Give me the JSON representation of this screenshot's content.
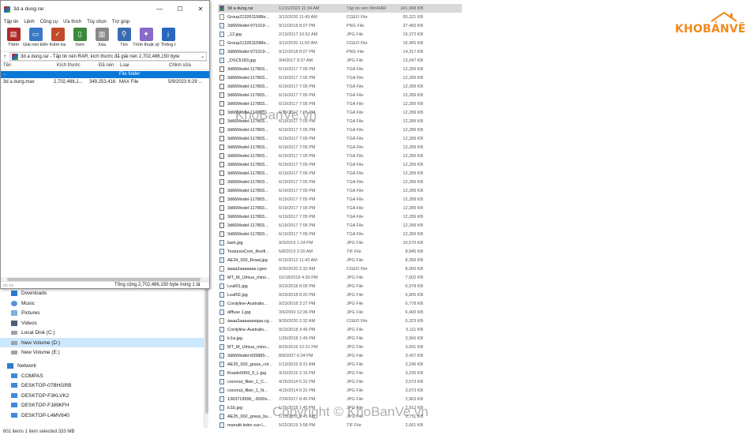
{
  "winrar": {
    "title": "3d a dung.rar",
    "window_controls": {
      "minimize": "—",
      "maximize": "☐",
      "close": "✕"
    },
    "menu": [
      "Tập tin",
      "Lệnh",
      "Công cụ",
      "Ưa thích",
      "Tùy chọn",
      "Trợ giúp"
    ],
    "toolbar": [
      {
        "label": "Thêm",
        "icon": "add-archive-icon",
        "color": "#b02a2a"
      },
      {
        "label": "Giải nén Đến",
        "icon": "extract-folder-icon",
        "color": "#3a78c8"
      },
      {
        "label": "Kiểm tra",
        "icon": "test-clipboard-icon",
        "color": "#c24a2a"
      },
      {
        "label": "Xem",
        "icon": "view-book-icon",
        "color": "#3a8a3a"
      },
      {
        "label": "Xóa",
        "icon": "delete-trash-icon",
        "color": "#8a8a8a"
      },
      {
        "label": "Tìm",
        "icon": "find-magnifier-icon",
        "color": "#3a6ab0"
      },
      {
        "label": "Trình thuật sỹ",
        "icon": "wizard-wand-icon",
        "color": "#8a6ac8"
      },
      {
        "label": "Thông t",
        "icon": "info-icon",
        "color": "#2a68c0"
      }
    ],
    "address": "3d a dung.rar - Tập tin nén RAR, kích thước đã giải nén 2,702,486,150 byte",
    "columns": [
      "Tên",
      "Kích thước",
      "Đã nén",
      "Loại",
      "Chỉnh sửa"
    ],
    "rows": [
      {
        "name": "..",
        "size": "",
        "packed": "",
        "type": "File folder",
        "modified": ""
      },
      {
        "name": "3d a dung.max",
        "size": "2,702,486,1...",
        "packed": "349,253,416",
        "type": "MAX File",
        "modified": "5/9/2023 6:29 ..."
      }
    ],
    "status_total": "Tổng cộng 2,702,486,150 byte trong 1 tậ"
  },
  "explorer": {
    "nav": [
      {
        "label": "Downloads",
        "icon": "downloads-icon"
      },
      {
        "label": "Music",
        "icon": "music-icon"
      },
      {
        "label": "Pictures",
        "icon": "pictures-icon"
      },
      {
        "label": "Videos",
        "icon": "videos-icon"
      },
      {
        "label": "Local Disk (C:)",
        "icon": "disk-icon"
      },
      {
        "label": "New Volume (D:)",
        "icon": "disk-icon"
      },
      {
        "label": "New Volume (E:)",
        "icon": "disk-icon"
      },
      {
        "label": "Network",
        "icon": "network-icon"
      },
      {
        "label": "COMPAS",
        "icon": "computer-icon"
      },
      {
        "label": "DESKTOP-07BHGRB",
        "icon": "computer-icon"
      },
      {
        "label": "DESKTOP-F3KLVK2",
        "icon": "computer-icon"
      },
      {
        "label": "DESKTOP-FJ89KFH",
        "icon": "computer-icon"
      },
      {
        "label": "DESKTOP-L4MV840",
        "icon": "computer-icon"
      }
    ],
    "status": "601 items     1 item selected  333 MB"
  },
  "files": [
    {
      "name": "3d a dung.rar",
      "date": "11/15/2023 11:34 AM",
      "type": "Tập tin nén WinRAR",
      "size": "341,068 KB",
      "kind": "rar"
    },
    {
      "name": "Group2132611588e...",
      "date": "3/13/2020 11:43 AM",
      "type": "CGEO File",
      "size": "65,321 KB",
      "kind": "doc"
    },
    {
      "name": "3d66Model-971019-...",
      "date": "9/12/2018 8:07 PM",
      "type": "PNG File",
      "size": "37,483 KB",
      "kind": "img"
    },
    {
      "name": "_12.jpg",
      "date": "2/13/2017 10:52 AM",
      "type": "JPG File",
      "size": "19,372 KB",
      "kind": "img"
    },
    {
      "name": "Group2132611588e...",
      "date": "3/13/2020 11:50 AM",
      "type": "CGEO File",
      "size": "16,465 KB",
      "kind": "doc"
    },
    {
      "name": "3d66Model-971019-...",
      "date": "9/12/2018 8:07 PM",
      "type": "PNG File",
      "size": "14,317 KB",
      "kind": "img"
    },
    {
      "name": "_DSC5183.jpg",
      "date": "3/4/2017 9:37 AM",
      "type": "JPG File",
      "size": "13,047 KB",
      "kind": "img"
    },
    {
      "name": "3d66Model-117803...",
      "date": "6/19/2017 7:05 PM",
      "type": "TGA File",
      "size": "12,289 KB",
      "kind": "tga"
    },
    {
      "name": "3d66Model-117803...",
      "date": "6/19/2017 7:05 PM",
      "type": "TGA File",
      "size": "12,289 KB",
      "kind": "tga"
    },
    {
      "name": "3d66Model-117803...",
      "date": "6/19/2017 7:05 PM",
      "type": "TGA File",
      "size": "12,289 KB",
      "kind": "tga"
    },
    {
      "name": "3d66Model-117803...",
      "date": "6/19/2017 7:05 PM",
      "type": "TGA File",
      "size": "12,289 KB",
      "kind": "tga"
    },
    {
      "name": "3d66Model-117803...",
      "date": "6/19/2017 7:05 PM",
      "type": "TGA File",
      "size": "12,289 KB",
      "kind": "tga"
    },
    {
      "name": "3d66Model-117803...",
      "date": "6/19/2017 7:05 PM",
      "type": "TGA File",
      "size": "12,289 KB",
      "kind": "tga"
    },
    {
      "name": "3d66Model-117803...",
      "date": "6/19/2017 7:05 PM",
      "type": "TGA File",
      "size": "12,289 KB",
      "kind": "tga"
    },
    {
      "name": "3d66Model-117803...",
      "date": "6/19/2017 7:05 PM",
      "type": "TGA File",
      "size": "12,289 KB",
      "kind": "tga"
    },
    {
      "name": "3d66Model-117803...",
      "date": "6/19/2017 7:05 PM",
      "type": "TGA File",
      "size": "12,289 KB",
      "kind": "tga"
    },
    {
      "name": "3d66Model-117803...",
      "date": "6/19/2017 7:05 PM",
      "type": "TGA File",
      "size": "12,289 KB",
      "kind": "tga"
    },
    {
      "name": "3d66Model-117803...",
      "date": "6/19/2017 7:05 PM",
      "type": "TGA File",
      "size": "12,289 KB",
      "kind": "tga"
    },
    {
      "name": "3d66Model-117803...",
      "date": "6/19/2017 7:05 PM",
      "type": "TGA File",
      "size": "12,289 KB",
      "kind": "tga"
    },
    {
      "name": "3d66Model-117803...",
      "date": "6/19/2017 7:05 PM",
      "type": "TGA File",
      "size": "12,289 KB",
      "kind": "tga"
    },
    {
      "name": "3d66Model-117803...",
      "date": "6/19/2017 7:05 PM",
      "type": "TGA File",
      "size": "12,289 KB",
      "kind": "tga"
    },
    {
      "name": "3d66Model-117803...",
      "date": "6/19/2017 7:05 PM",
      "type": "TGA File",
      "size": "12,289 KB",
      "kind": "tga"
    },
    {
      "name": "3d66Model-117803...",
      "date": "6/19/2017 7:05 PM",
      "type": "TGA File",
      "size": "12,289 KB",
      "kind": "tga"
    },
    {
      "name": "3d66Model-117803...",
      "date": "6/19/2017 7:05 PM",
      "type": "TGA File",
      "size": "12,289 KB",
      "kind": "tga"
    },
    {
      "name": "3d66Model-117803...",
      "date": "6/19/2017 7:05 PM",
      "type": "TGA File",
      "size": "12,289 KB",
      "kind": "tga"
    },
    {
      "name": "3d66Model-117803...",
      "date": "6/19/2017 7:05 PM",
      "type": "TGA File",
      "size": "12,289 KB",
      "kind": "tga"
    },
    {
      "name": "3d66Model-117803...",
      "date": "6/19/2017 7:05 PM",
      "type": "TGA File",
      "size": "12,289 KB",
      "kind": "tga"
    },
    {
      "name": "bark.jpg",
      "date": "9/3/2019 1:24 PM",
      "type": "JPG File",
      "size": "10,670 KB",
      "kind": "img"
    },
    {
      "name": "TexturesCom_Roofi...",
      "date": "5/8/2019 2:20 AM",
      "type": "TIF File",
      "size": "8,845 KB",
      "kind": "img"
    },
    {
      "name": "AE24_002_Road.jpg",
      "date": "6/15/2013 11:42 AM",
      "type": "JPG File",
      "size": "8,399 KB",
      "kind": "img"
    },
    {
      "name": "áaaa2aaaaaas.cgeo",
      "date": "9/30/2020 2:32 AM",
      "type": "CGEO File",
      "size": "8,060 KB",
      "kind": "doc"
    },
    {
      "name": "MT_M_Ulmus_mino...",
      "date": "10/18/2018 4:36 PM",
      "type": "JPG File",
      "size": "7,602 KB",
      "kind": "img"
    },
    {
      "name": "Leaf01.jpg",
      "date": "9/23/2018 8:05 PM",
      "type": "JPG File",
      "size": "6,978 KB",
      "kind": "img"
    },
    {
      "name": "Leaf02.jpg",
      "date": "9/23/2018 8:20 PM",
      "type": "JPG File",
      "size": "6,905 KB",
      "kind": "img"
    },
    {
      "name": "Cordyline-Australis...",
      "date": "9/23/2018 3:27 PM",
      "type": "JPG File",
      "size": "6,778 KB",
      "kind": "img"
    },
    {
      "name": "diffuse 1.jpg",
      "date": "3/6/2009 12:36 PM",
      "type": "JPG File",
      "size": "6,400 KB",
      "kind": "img"
    },
    {
      "name": "áaaa2aaaasasqaa.cg...",
      "date": "9/30/2020 2:32 AM",
      "type": "CGEO File",
      "size": "6,323 KB",
      "kind": "doc"
    },
    {
      "name": "Cordyline-Australis...",
      "date": "9/23/2018 3:46 PM",
      "type": "JPG File",
      "size": "5,111 KB",
      "kind": "img"
    },
    {
      "name": "lc1a.jpg",
      "date": "1/26/2018 1:45 PM",
      "type": "JPG File",
      "size": "3,966 KB",
      "kind": "img"
    },
    {
      "name": "MT_M_Ulmus_mino...",
      "date": "8/29/2016 12:21 PM",
      "type": "JPG File",
      "size": "3,691 KB",
      "kind": "img"
    },
    {
      "name": "3d66Model-609885-...",
      "date": "8/8/2007 6:34 PM",
      "type": "JPG File",
      "size": "3,437 KB",
      "kind": "img"
    },
    {
      "name": "AE25_002_grass_col...",
      "date": "1/13/2015 9:31 AM",
      "type": "JPG File",
      "size": "3,246 KB",
      "kind": "img"
    },
    {
      "name": "Roads0069_5_L.jpg",
      "date": "3/10/2015 2:15 PM",
      "type": "JPG File",
      "size": "3,230 KB",
      "kind": "img"
    },
    {
      "name": "coconut_fiber_1_C...",
      "date": "4/15/2014 5:31 PM",
      "type": "JPG File",
      "size": "3,073 KB",
      "kind": "img"
    },
    {
      "name": "coconut_fiber_1_N...",
      "date": "4/15/2014 5:31 PM",
      "type": "JPG File",
      "size": "3,073 KB",
      "kind": "img"
    },
    {
      "name": "1363719996_-3000x...",
      "date": "7/24/2017 8:45 PM",
      "type": "JPG File",
      "size": "2,963 KB",
      "kind": "img"
    },
    {
      "name": "lc1b.jpg",
      "date": "1/26/2018 1:45 PM",
      "type": "JPG File",
      "size": "2,912 KB",
      "kind": "img"
    },
    {
      "name": "AE25_002_grass_bu...",
      "date": "1/13/2015 9:41 AM",
      "type": "JPG File",
      "size": "2,711 KB",
      "kind": "img"
    },
    {
      "name": "manutti kobo sun l...",
      "date": "5/22/2019 3:58 PM",
      "type": "TIF File",
      "size": "2,661 KB",
      "kind": "img"
    }
  ],
  "logo": {
    "text": "KHOBẢNVẼ",
    "color": "#f08a1c"
  },
  "watermarks": {
    "center": "KhoBanVe.vn",
    "bottom": "Copyright © KhoBanVe.vn"
  }
}
